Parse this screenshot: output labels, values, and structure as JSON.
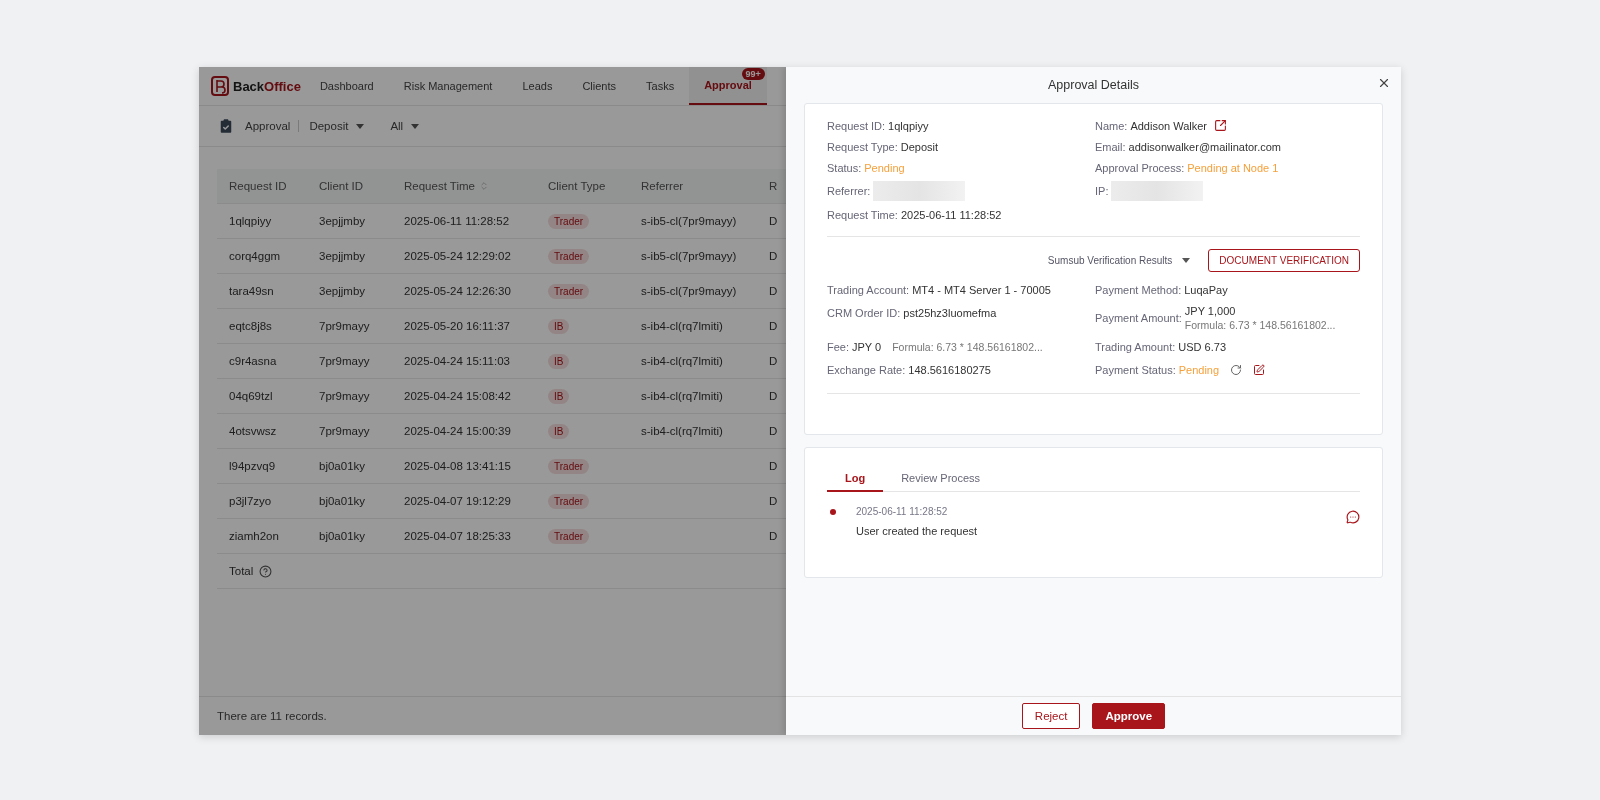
{
  "nav": {
    "brand_dark": "Back",
    "brand_accent": "Office",
    "items": [
      {
        "label": "Dashboard",
        "selected": false
      },
      {
        "label": "Risk Management",
        "selected": false
      },
      {
        "label": "Leads",
        "selected": false
      },
      {
        "label": "Clients",
        "selected": false
      },
      {
        "label": "Tasks",
        "selected": false
      },
      {
        "label": "Approval",
        "selected": true,
        "badge": "99+"
      }
    ]
  },
  "toolbar": {
    "title": "Approval",
    "filters": [
      "Deposit",
      "All"
    ]
  },
  "table": {
    "columns": [
      {
        "label": "Request ID"
      },
      {
        "label": "Client ID"
      },
      {
        "label": "Request Time",
        "sortable": true
      },
      {
        "label": "Client Type"
      },
      {
        "label": "Referrer"
      },
      {
        "label": "R"
      }
    ],
    "rows": [
      {
        "cells": [
          "1qlqpiyy",
          "3epjjmby",
          "2025-06-11 11:28:52",
          "Trader",
          "s-ib5-cl(7pr9mayy)",
          "D"
        ]
      },
      {
        "cells": [
          "corq4ggm",
          "3epjjmby",
          "2025-05-24 12:29:02",
          "Trader",
          "s-ib5-cl(7pr9mayy)",
          "D"
        ]
      },
      {
        "cells": [
          "tara49sn",
          "3epjjmby",
          "2025-05-24 12:26:30",
          "Trader",
          "s-ib5-cl(7pr9mayy)",
          "D"
        ]
      },
      {
        "cells": [
          "eqtc8j8s",
          "7pr9mayy",
          "2025-05-20 16:11:37",
          "IB",
          "s-ib4-cl(rq7lmiti)",
          "D"
        ]
      },
      {
        "cells": [
          "c9r4asna",
          "7pr9mayy",
          "2025-04-24 15:11:03",
          "IB",
          "s-ib4-cl(rq7lmiti)",
          "D"
        ]
      },
      {
        "cells": [
          "04q69tzl",
          "7pr9mayy",
          "2025-04-24 15:08:42",
          "IB",
          "s-ib4-cl(rq7lmiti)",
          "D"
        ]
      },
      {
        "cells": [
          "4otsvwsz",
          "7pr9mayy",
          "2025-04-24 15:00:39",
          "IB",
          "s-ib4-cl(rq7lmiti)",
          "D"
        ]
      },
      {
        "cells": [
          "l94pzvq9",
          "bj0a01ky",
          "2025-04-08 13:41:15",
          "Trader",
          null,
          "D"
        ]
      },
      {
        "cells": [
          "p3jl7zyo",
          "bj0a01ky",
          "2025-04-07 19:12:29",
          "Trader",
          null,
          "D"
        ]
      },
      {
        "cells": [
          "ziamh2on",
          "bj0a01ky",
          "2025-04-07 18:25:33",
          "Trader",
          null,
          "D"
        ]
      }
    ],
    "total_label": "Total"
  },
  "footer": "There are 11 records.",
  "drawer": {
    "title": "Approval Details",
    "summary": [
      {
        "label": "Request ID:",
        "value": "1qlqpiyy",
        "kind": "text"
      },
      {
        "label": "Name:",
        "value": "Addison Walker",
        "kind": "link"
      },
      {
        "label": "Request Type:",
        "value": "Deposit",
        "kind": "text"
      },
      {
        "label": "Email:",
        "value": "addisonwalker@mailinator.com",
        "kind": "text"
      },
      {
        "label": "Status:",
        "value": "Pending",
        "kind": "status"
      },
      {
        "label": "Approval Process:",
        "value": "Pending at Node 1",
        "kind": "status"
      },
      {
        "label": "Referrer:",
        "kind": "redacted"
      },
      {
        "label": "IP:",
        "kind": "redacted"
      },
      {
        "label": "Request Time:",
        "value": "2025-06-11 11:28:52",
        "kind": "text"
      }
    ],
    "verification_select": "Sumsub Verification Results",
    "document_button": "DOCUMENT VERIFICATION",
    "payment": [
      {
        "label": "Trading Account:",
        "value": "MT4 - MT4 Server 1 - 70005",
        "kind": "text"
      },
      {
        "label": "Payment Method:",
        "value": "LuqaPay",
        "kind": "text"
      },
      {
        "label": "CRM Order ID:",
        "value": "pst25hz3luomefma",
        "kind": "text"
      },
      {
        "label": "Payment Amount:",
        "value": "JPY 1,000",
        "note": "Formula: 6.73 * 148.56161802...",
        "kind": "stacked"
      },
      {
        "label": "Fee:",
        "value": "JPY 0",
        "note": "Formula: 6.73 * 148.56161802...",
        "kind": "inline"
      },
      {
        "label": "Trading Amount:",
        "value": "USD 6.73",
        "kind": "text"
      },
      {
        "label": "Exchange Rate:",
        "value": "148.5616180275",
        "kind": "text"
      },
      {
        "label": "Payment Status:",
        "value": "Pending",
        "kind": "status_actions"
      }
    ],
    "tabs": [
      {
        "label": "Log",
        "selected": true
      },
      {
        "label": "Review Process",
        "selected": false
      }
    ],
    "log": [
      {
        "time": "2025-06-11 11:28:52",
        "text": "User created the request"
      }
    ],
    "buttons": [
      {
        "label": "Reject",
        "kind": "outline"
      },
      {
        "label": "Approve",
        "kind": "primary"
      }
    ]
  }
}
